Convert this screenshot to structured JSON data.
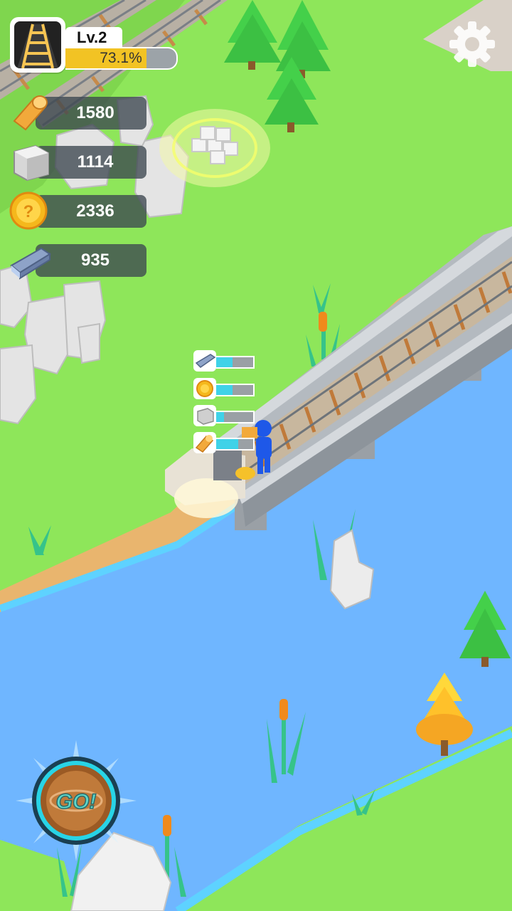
{
  "hud": {
    "level_label": "Lv.2",
    "progress_text": "73.1%",
    "progress_fraction": 0.731
  },
  "resources": [
    {
      "name": "wood-log",
      "icon": "log-icon",
      "value": "1580"
    },
    {
      "name": "stone-block",
      "icon": "stone-block-icon",
      "value": "1114"
    },
    {
      "name": "coin",
      "icon": "coin-icon",
      "value": "2336"
    },
    {
      "name": "steel-rail",
      "icon": "rail-icon",
      "value": "935"
    }
  ],
  "worker_meters": [
    {
      "icon": "rail-icon",
      "fill": 0.45
    },
    {
      "icon": "coin-icon",
      "fill": 0.45
    },
    {
      "icon": "stone-block-icon",
      "fill": 0.22
    },
    {
      "icon": "log-icon",
      "fill": 0.6
    }
  ],
  "go_button": {
    "label": "GO!"
  },
  "colors": {
    "grass": "#8ee65a",
    "water": "#6fb6ff",
    "sand": "#e9b56e",
    "progress": "#f2c324",
    "meter": "#3fd2e8"
  }
}
